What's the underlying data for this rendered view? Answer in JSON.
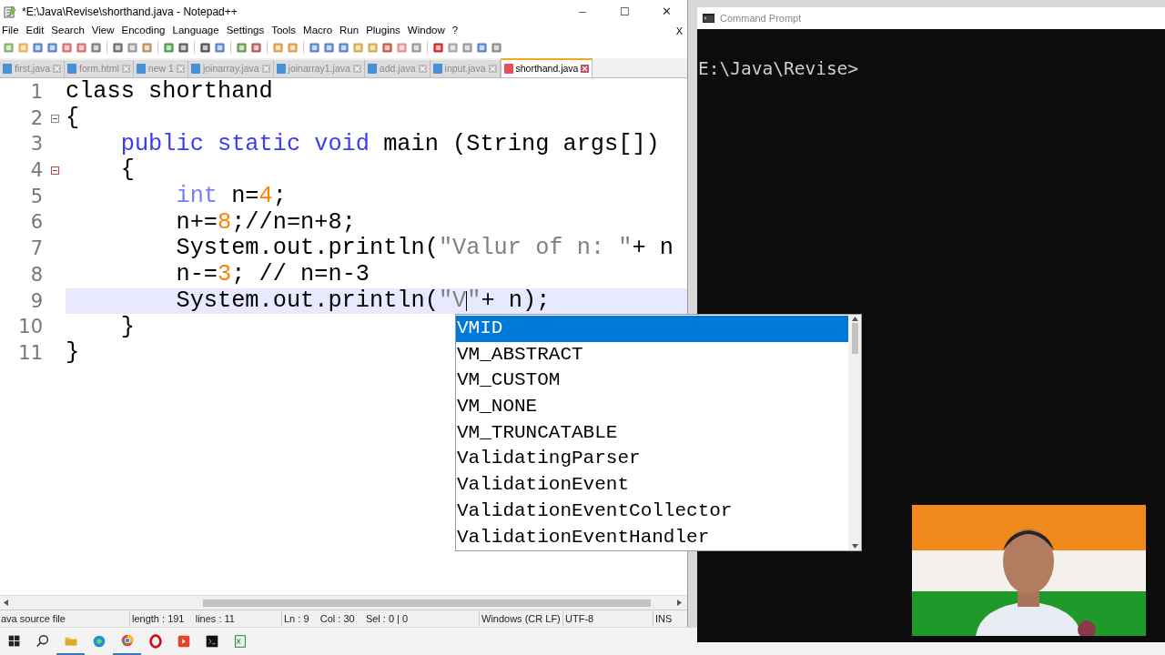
{
  "editor_window": {
    "title": "*E:\\Java\\Revise\\shorthand.java - Notepad++",
    "minimize": "─",
    "maximize": "☐",
    "close": "✕",
    "doc_close": "X"
  },
  "menu": [
    "File",
    "Edit",
    "Search",
    "View",
    "Encoding",
    "Language",
    "Settings",
    "Tools",
    "Macro",
    "Run",
    "Plugins",
    "Window",
    "?"
  ],
  "tabs": [
    {
      "label": "first.java",
      "selected": false
    },
    {
      "label": "form.html",
      "selected": false
    },
    {
      "label": "new 1",
      "selected": false
    },
    {
      "label": "joinarray.java",
      "selected": false
    },
    {
      "label": "joinarray1.java",
      "selected": false
    },
    {
      "label": "add.java",
      "selected": false
    },
    {
      "label": "input.java",
      "selected": false
    },
    {
      "label": "shorthand.java",
      "selected": true
    }
  ],
  "code_lines": [
    {
      "number": "1",
      "current": false,
      "tokens": [
        {
          "kind": "plain",
          "text": "class shorthand"
        }
      ]
    },
    {
      "number": "2",
      "current": false,
      "tokens": [
        {
          "kind": "plain",
          "text": "{"
        }
      ]
    },
    {
      "number": "3",
      "current": false,
      "tokens": [
        {
          "kind": "keyword",
          "text": "    public static void"
        },
        {
          "kind": "plain",
          "text": " main (String args[])"
        }
      ]
    },
    {
      "number": "4",
      "current": false,
      "tokens": [
        {
          "kind": "plain",
          "text": "    {"
        }
      ]
    },
    {
      "number": "5",
      "current": false,
      "tokens": [
        {
          "kind": "type",
          "text": "        int"
        },
        {
          "kind": "plain",
          "text": " n="
        },
        {
          "kind": "number",
          "text": "4"
        },
        {
          "kind": "plain",
          "text": ";"
        }
      ]
    },
    {
      "number": "6",
      "current": false,
      "tokens": [
        {
          "kind": "plain",
          "text": "        n+="
        },
        {
          "kind": "number",
          "text": "8"
        },
        {
          "kind": "plain",
          "text": ";//n=n+8;"
        }
      ]
    },
    {
      "number": "7",
      "current": false,
      "tokens": [
        {
          "kind": "plain",
          "text": "        System.out.println("
        },
        {
          "kind": "string",
          "text": "\"Valur of n: \""
        },
        {
          "kind": "plain",
          "text": "+ n"
        }
      ]
    },
    {
      "number": "8",
      "current": false,
      "tokens": [
        {
          "kind": "plain",
          "text": "        n-="
        },
        {
          "kind": "number",
          "text": "3"
        },
        {
          "kind": "plain",
          "text": "; // n=n-3"
        }
      ]
    },
    {
      "number": "9",
      "current": true,
      "tokens": [
        {
          "kind": "plain",
          "text": "        System.out.println("
        },
        {
          "kind": "string",
          "text": "\"V"
        },
        {
          "kind": "caret"
        },
        {
          "kind": "string",
          "text": "\""
        },
        {
          "kind": "plain",
          "text": "+ n);"
        }
      ]
    },
    {
      "number": "10",
      "current": false,
      "tokens": [
        {
          "kind": "plain",
          "text": "    }"
        }
      ]
    },
    {
      "number": "11",
      "current": false,
      "tokens": [
        {
          "kind": "plain",
          "text": "}"
        }
      ]
    }
  ],
  "autocomplete": [
    {
      "label": "VMID",
      "selected": true
    },
    {
      "label": "VM_ABSTRACT",
      "selected": false
    },
    {
      "label": "VM_CUSTOM",
      "selected": false
    },
    {
      "label": "VM_NONE",
      "selected": false
    },
    {
      "label": "VM_TRUNCATABLE",
      "selected": false
    },
    {
      "label": "ValidatingParser",
      "selected": false
    },
    {
      "label": "ValidationEvent",
      "selected": false
    },
    {
      "label": "ValidationEventCollector",
      "selected": false
    },
    {
      "label": "ValidationEventHandler",
      "selected": false
    }
  ],
  "status_bar": [
    "ava source file",
    "length : 191    lines : 11",
    "Ln : 9    Col : 30    Sel : 0 | 0",
    "Windows (CR LF)",
    "UTF-8",
    "INS"
  ],
  "command_prompt": {
    "title": "Command Prompt",
    "prompt": "E:\\Java\\Revise>"
  }
}
